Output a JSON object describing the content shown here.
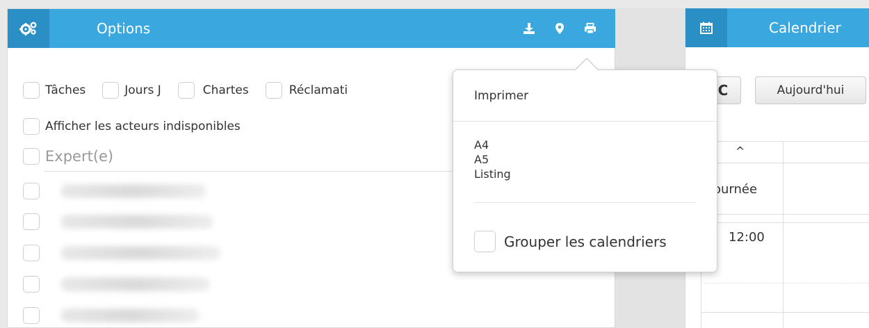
{
  "options_panel": {
    "title": "Options",
    "header_icon": "gears-icon",
    "tools": [
      "download-icon",
      "map-marker-icon",
      "print-icon"
    ],
    "filters_row1": [
      "Tâches",
      "Jours J",
      "Chartes",
      "Réclamati"
    ],
    "filters_row2": "Afficher les acteurs indisponibles",
    "expert_placeholder": "Expert(e)"
  },
  "calendar_panel": {
    "title": "Calendrier",
    "header_icon": "calendar-icon",
    "refresh_label": "C",
    "today_label": "Aujourd'hui",
    "sort_arrow": "^",
    "allday_label": "ournée",
    "time_label": "12:00"
  },
  "print_popover": {
    "title": "Imprimer",
    "options": [
      "A4",
      "A5",
      "Listing"
    ],
    "group_label": "Grouper les calendriers"
  },
  "colors": {
    "header_blue": "#3aa8df",
    "header_icon_bg": "#2a8fc4"
  }
}
